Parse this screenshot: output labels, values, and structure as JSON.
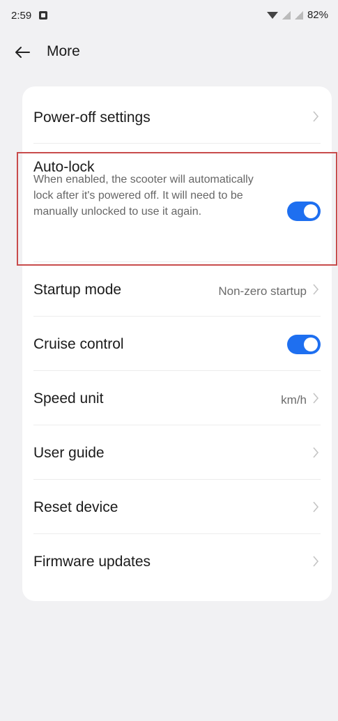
{
  "status_bar": {
    "time": "2:59",
    "battery": "82%"
  },
  "header": {
    "title": "More"
  },
  "settings": {
    "power_off": {
      "label": "Power-off settings"
    },
    "auto_lock": {
      "label": "Auto-lock",
      "description": "When enabled, the scooter will automatically lock after it's powered off. It will need to be manually unlocked to use it again.",
      "enabled": true
    },
    "startup_mode": {
      "label": "Startup mode",
      "value": "Non-zero startup"
    },
    "cruise_control": {
      "label": "Cruise control",
      "enabled": true
    },
    "speed_unit": {
      "label": "Speed unit",
      "value": "km/h"
    },
    "user_guide": {
      "label": "User guide"
    },
    "reset_device": {
      "label": "Reset device"
    },
    "firmware_updates": {
      "label": "Firmware updates"
    }
  },
  "colors": {
    "accent": "#1e6ff0",
    "highlight": "#c84b4b",
    "background": "#f1f1f3"
  },
  "icons": {
    "back": "arrow-left-icon",
    "chevron": "chevron-right-icon"
  }
}
